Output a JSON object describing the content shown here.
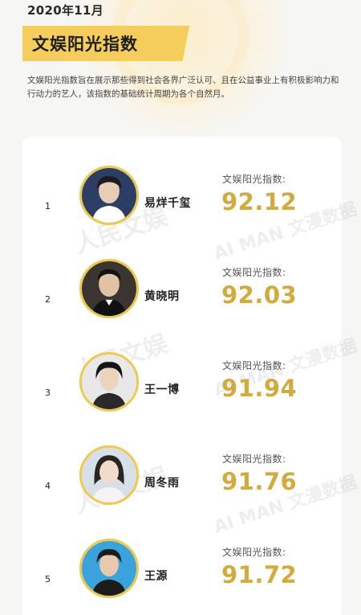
{
  "header": {
    "date": "2020年11月",
    "title": "文娱阳光指数",
    "description": "文娱阳光指数旨在展示那些得到社会各界广泛认可、且在公益事业上有积极影响力和行动力的艺人，该指数的基础统计周期为各个自然月。"
  },
  "ranking": [
    {
      "rank": "1",
      "name": "易烊千玺",
      "score_label": "文娱阳光指数:",
      "score": "92.12",
      "avatar_bg": "#2c3e63"
    },
    {
      "rank": "2",
      "name": "黄晓明",
      "score_label": "文娱阳光指数:",
      "score": "92.03",
      "avatar_bg": "#3a3530"
    },
    {
      "rank": "3",
      "name": "王一博",
      "score_label": "文娱阳光指数:",
      "score": "91.94",
      "avatar_bg": "#e8e8e8"
    },
    {
      "rank": "4",
      "name": "周冬雨",
      "score_label": "文娱阳光指数:",
      "score": "91.76",
      "avatar_bg": "#d7dfe8"
    },
    {
      "rank": "5",
      "name": "王源",
      "score_label": "文娱阳光指数:",
      "score": "91.72",
      "avatar_bg": "#3aa3dc"
    }
  ],
  "colors": {
    "accent": "#f4cd5c",
    "score": "#d3aa3c",
    "avatar_border": "#efc94d"
  }
}
